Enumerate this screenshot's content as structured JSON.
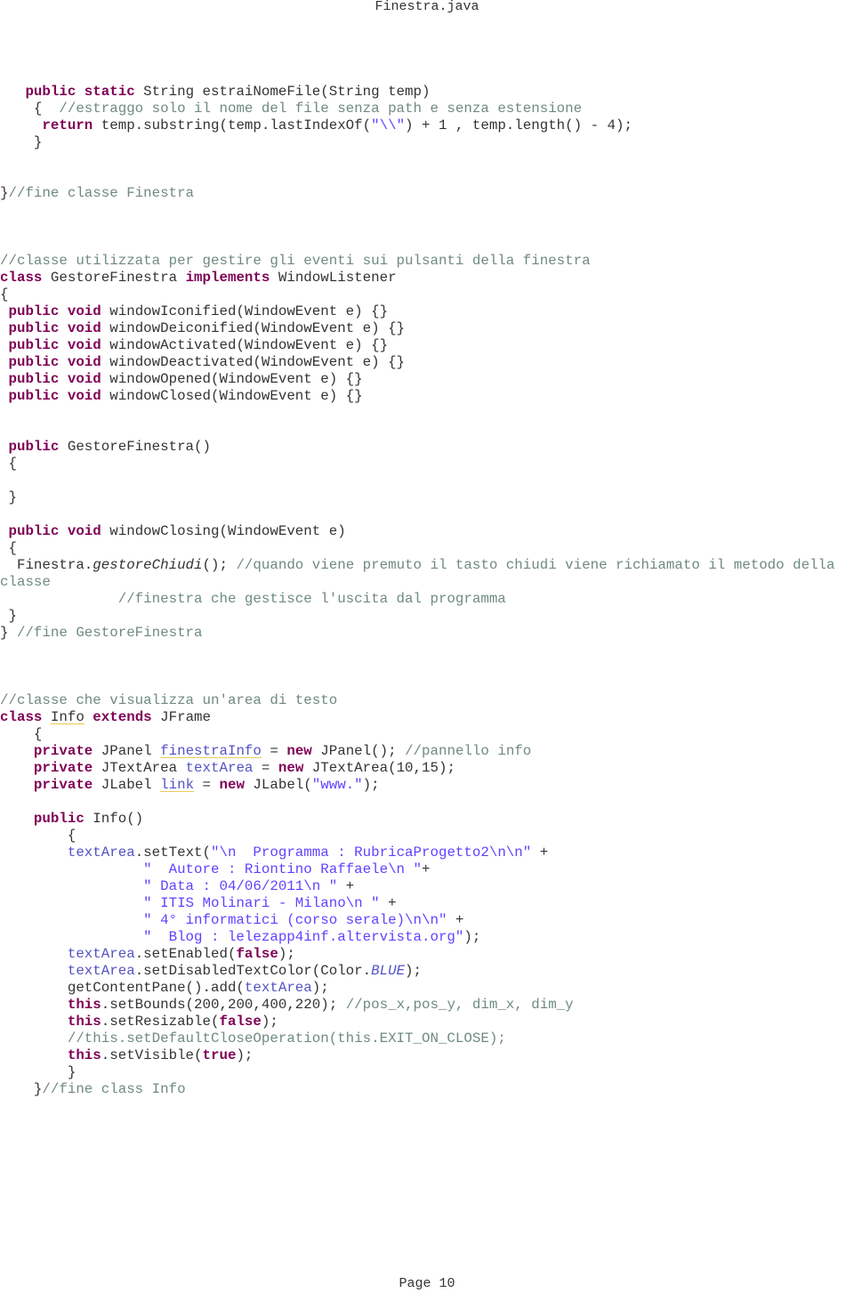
{
  "document": {
    "title": "Finestra.java",
    "footer": "Page 10"
  },
  "colors": {
    "keyword": "#7f0055",
    "comment": "#6f8a7f",
    "string": "#2a00ff",
    "field": "#3f3fbf",
    "text": "#333333"
  },
  "code_lines": [
    [
      [
        "   ",
        ""
      ],
      [
        "public static ",
        "kw"
      ],
      [
        "String estraiNomeFile(String temp)",
        ""
      ]
    ],
    [
      [
        "    { ",
        ""
      ],
      [
        " //estraggo solo il nome del file senza path e senza estensione",
        "cm"
      ]
    ],
    [
      [
        "     ",
        ""
      ],
      [
        "return ",
        "kw"
      ],
      [
        "temp.substring(temp.lastIndexOf(",
        ""
      ],
      [
        "\"\\\\\"",
        "str"
      ],
      [
        ") + 1 , temp.length() - 4);",
        ""
      ]
    ],
    [
      [
        "    }",
        ""
      ]
    ],
    [
      [
        "",
        ""
      ]
    ],
    [
      [
        "",
        ""
      ]
    ],
    [
      [
        "}",
        ""
      ],
      [
        "//fine classe Finestra",
        "cm"
      ]
    ],
    [
      [
        "",
        ""
      ]
    ],
    [
      [
        "",
        ""
      ]
    ],
    [
      [
        "",
        ""
      ]
    ],
    [
      [
        "//classe utilizzata per gestire gli eventi sui pulsanti della finestra",
        "cm"
      ]
    ],
    [
      [
        "class ",
        "kw"
      ],
      [
        "GestoreFinestra ",
        ""
      ],
      [
        "implements ",
        "kw"
      ],
      [
        "WindowListener",
        ""
      ]
    ],
    [
      [
        "{",
        ""
      ]
    ],
    [
      [
        " ",
        ""
      ],
      [
        "public void ",
        "kw"
      ],
      [
        "windowIconified(WindowEvent e) {}",
        ""
      ]
    ],
    [
      [
        " ",
        ""
      ],
      [
        "public void ",
        "kw"
      ],
      [
        "windowDeiconified(WindowEvent e) {}",
        ""
      ]
    ],
    [
      [
        " ",
        ""
      ],
      [
        "public void ",
        "kw"
      ],
      [
        "windowActivated(WindowEvent e) {}",
        ""
      ]
    ],
    [
      [
        " ",
        ""
      ],
      [
        "public void ",
        "kw"
      ],
      [
        "windowDeactivated(WindowEvent e) {}",
        ""
      ]
    ],
    [
      [
        " ",
        ""
      ],
      [
        "public void ",
        "kw"
      ],
      [
        "windowOpened(WindowEvent e) {}",
        ""
      ]
    ],
    [
      [
        " ",
        ""
      ],
      [
        "public void ",
        "kw"
      ],
      [
        "windowClosed(WindowEvent e) {}",
        ""
      ]
    ],
    [
      [
        "",
        ""
      ]
    ],
    [
      [
        "",
        ""
      ]
    ],
    [
      [
        " ",
        ""
      ],
      [
        "public ",
        "kw"
      ],
      [
        "GestoreFinestra()",
        ""
      ]
    ],
    [
      [
        " {",
        ""
      ]
    ],
    [
      [
        "",
        ""
      ]
    ],
    [
      [
        " }",
        ""
      ]
    ],
    [
      [
        "",
        ""
      ]
    ],
    [
      [
        " ",
        ""
      ],
      [
        "public void ",
        "kw"
      ],
      [
        "windowClosing(WindowEvent e)",
        ""
      ]
    ],
    [
      [
        " {",
        ""
      ]
    ],
    [
      [
        "  Finestra.",
        ""
      ],
      [
        "gestoreChiudi",
        "it"
      ],
      [
        "(); ",
        ""
      ],
      [
        "//quando viene premuto il tasto chiudi viene richiamato il metodo della",
        "cm"
      ]
    ],
    [
      [
        "classe",
        "cm"
      ]
    ],
    [
      [
        "              ",
        ""
      ],
      [
        "//finestra che gestisce l'uscita dal programma",
        "cm"
      ]
    ],
    [
      [
        " }",
        ""
      ]
    ],
    [
      [
        "} ",
        ""
      ],
      [
        "//fine GestoreFinestra",
        "cm"
      ]
    ],
    [
      [
        "",
        ""
      ]
    ],
    [
      [
        "",
        ""
      ]
    ],
    [
      [
        "",
        ""
      ]
    ],
    [
      [
        "//classe che visualizza un'area di testo",
        "cm"
      ]
    ],
    [
      [
        "class ",
        "kw"
      ],
      [
        "Info",
        "warn"
      ],
      [
        " ",
        ""
      ],
      [
        "extends ",
        "kw"
      ],
      [
        "JFrame",
        ""
      ]
    ],
    [
      [
        "    {",
        ""
      ]
    ],
    [
      [
        "    ",
        ""
      ],
      [
        "private ",
        "kw"
      ],
      [
        "JPanel ",
        ""
      ],
      [
        "finestraInfo",
        "warn fld"
      ],
      [
        " = ",
        ""
      ],
      [
        "new ",
        "kw"
      ],
      [
        "JPanel(); ",
        ""
      ],
      [
        "//pannello info",
        "cm"
      ]
    ],
    [
      [
        "    ",
        ""
      ],
      [
        "private ",
        "kw"
      ],
      [
        "JTextArea ",
        ""
      ],
      [
        "textArea",
        "fld"
      ],
      [
        " = ",
        ""
      ],
      [
        "new ",
        "kw"
      ],
      [
        "JTextArea(10,15);",
        ""
      ]
    ],
    [
      [
        "    ",
        ""
      ],
      [
        "private ",
        "kw"
      ],
      [
        "JLabel ",
        ""
      ],
      [
        "link",
        "warn fld"
      ],
      [
        " = ",
        ""
      ],
      [
        "new ",
        "kw"
      ],
      [
        "JLabel(",
        ""
      ],
      [
        "\"www.\"",
        "str"
      ],
      [
        ");",
        ""
      ]
    ],
    [
      [
        "",
        ""
      ]
    ],
    [
      [
        "    ",
        ""
      ],
      [
        "public ",
        "kw"
      ],
      [
        "Info()",
        ""
      ]
    ],
    [
      [
        "        {",
        ""
      ]
    ],
    [
      [
        "        ",
        ""
      ],
      [
        "textArea",
        "fld"
      ],
      [
        ".setText(",
        ""
      ],
      [
        "\"\\n  Programma : RubricaProgetto2\\n\\n\"",
        "str"
      ],
      [
        " +",
        ""
      ]
    ],
    [
      [
        "                 ",
        ""
      ],
      [
        "\"  Autore : Riontino Raffaele\\n \"",
        "str"
      ],
      [
        "+",
        ""
      ]
    ],
    [
      [
        "                 ",
        ""
      ],
      [
        "\" Data : 04/06/2011\\n \"",
        "str"
      ],
      [
        " +",
        ""
      ]
    ],
    [
      [
        "                 ",
        ""
      ],
      [
        "\" ITIS Molinari - Milano\\n \"",
        "str"
      ],
      [
        " +",
        ""
      ]
    ],
    [
      [
        "                 ",
        ""
      ],
      [
        "\" 4° informatici (corso serale)\\n\\n\"",
        "str"
      ],
      [
        " +",
        ""
      ]
    ],
    [
      [
        "                 ",
        ""
      ],
      [
        "\"  Blog : lelezapp4inf.altervista.org\"",
        "str"
      ],
      [
        ");",
        ""
      ]
    ],
    [
      [
        "        ",
        ""
      ],
      [
        "textArea",
        "fld"
      ],
      [
        ".setEnabled(",
        ""
      ],
      [
        "false",
        "kw"
      ],
      [
        ");",
        ""
      ]
    ],
    [
      [
        "        ",
        ""
      ],
      [
        "textArea",
        "fld"
      ],
      [
        ".setDisabledTextColor(Color.",
        ""
      ],
      [
        "BLUE",
        "fld it"
      ],
      [
        ");",
        ""
      ]
    ],
    [
      [
        "        getContentPane().add(",
        ""
      ],
      [
        "textArea",
        "fld"
      ],
      [
        ");",
        ""
      ]
    ],
    [
      [
        "        ",
        ""
      ],
      [
        "this",
        "kw"
      ],
      [
        ".setBounds(200,200,400,220); ",
        ""
      ],
      [
        "//pos_x,pos_y, dim_x, dim_y",
        "cm"
      ]
    ],
    [
      [
        "        ",
        ""
      ],
      [
        "this",
        "kw"
      ],
      [
        ".setResizable(",
        ""
      ],
      [
        "false",
        "kw"
      ],
      [
        ");",
        ""
      ]
    ],
    [
      [
        "        ",
        ""
      ],
      [
        "//this.setDefaultCloseOperation(this.EXIT_ON_CLOSE);",
        "cm"
      ]
    ],
    [
      [
        "        ",
        ""
      ],
      [
        "this",
        "kw"
      ],
      [
        ".setVisible(",
        ""
      ],
      [
        "true",
        "kw"
      ],
      [
        ");",
        ""
      ]
    ],
    [
      [
        "        }",
        ""
      ]
    ],
    [
      [
        "    }",
        ""
      ],
      [
        "//fine class Info",
        "cm"
      ]
    ]
  ]
}
